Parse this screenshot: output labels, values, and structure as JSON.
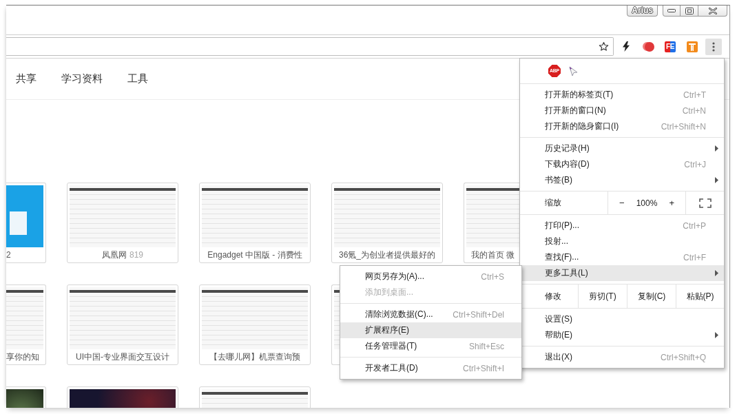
{
  "title_bar": {
    "user_badge": "Arius"
  },
  "toolbar": {
    "extension_badge": "FE"
  },
  "nav": {
    "links": [
      "共享",
      "学习资料",
      "工具"
    ]
  },
  "tile_rows": [
    {
      "tiles": [
        {
          "kind": "app",
          "title": "2"
        },
        {
          "kind": "page",
          "title": "凤凰网",
          "count": "819"
        },
        {
          "kind": "page",
          "title": "Engadget 中国版 - 消费性"
        },
        {
          "kind": "page",
          "title": "36氪_为创业者提供最好的"
        },
        {
          "kind": "page",
          "title": "我的首页 微"
        }
      ]
    },
    {
      "tiles": [
        {
          "kind": "page",
          "title": "享你的知"
        },
        {
          "kind": "page",
          "title": "UI中国-专业界面交互设计"
        },
        {
          "kind": "page",
          "title": "【去哪儿网】机票查询预"
        },
        {
          "kind": "page"
        }
      ]
    },
    {
      "tiles": [
        {
          "kind": "photo"
        },
        {
          "kind": "dark-page"
        },
        {
          "kind": "page"
        }
      ]
    }
  ],
  "menu": {
    "extension_badge": "ABP",
    "sections": [
      {
        "kind": "items",
        "items": [
          {
            "label": "打开新的标签页(T)",
            "shortcut": "Ctrl+T",
            "has_submenu": false,
            "selected": false
          },
          {
            "label": "打开新的窗口(N)",
            "shortcut": "Ctrl+N",
            "has_submenu": false,
            "selected": false
          },
          {
            "label": "打开新的隐身窗口(I)",
            "shortcut": "Ctrl+Shift+N",
            "has_submenu": false,
            "selected": false
          }
        ]
      },
      {
        "kind": "items",
        "items": [
          {
            "label": "历史记录(H)",
            "has_submenu": true,
            "selected": false
          },
          {
            "label": "下载内容(D)",
            "shortcut": "Ctrl+J",
            "has_submenu": false,
            "selected": false
          },
          {
            "label": "书签(B)",
            "has_submenu": true,
            "selected": false
          }
        ]
      },
      {
        "kind": "zoom",
        "label": "缩放",
        "decrease": "−",
        "reading": "100%",
        "increase": "+"
      },
      {
        "kind": "items",
        "items": [
          {
            "label": "打印(P)...",
            "shortcut": "Ctrl+P",
            "has_submenu": false,
            "selected": false
          },
          {
            "label": "投射...",
            "has_submenu": false,
            "selected": false
          },
          {
            "label": "查找(F)...",
            "shortcut": "Ctrl+F",
            "has_submenu": false,
            "selected": false
          },
          {
            "label": "更多工具(L)",
            "has_submenu": true,
            "selected": true
          }
        ]
      },
      {
        "kind": "edit",
        "label": "修改",
        "actions": [
          "剪切(T)",
          "复制(C)",
          "粘贴(P)"
        ]
      },
      {
        "kind": "items",
        "items": [
          {
            "label": "设置(S)",
            "has_submenu": false,
            "selected": false
          },
          {
            "label": "帮助(E)",
            "has_submenu": true,
            "selected": false
          }
        ]
      },
      {
        "kind": "items",
        "items": [
          {
            "label": "退出(X)",
            "shortcut": "Ctrl+Shift+Q",
            "has_submenu": false,
            "selected": false
          }
        ]
      }
    ]
  },
  "submenu": {
    "sections": [
      {
        "items": [
          {
            "label": "网页另存为(A)...",
            "shortcut": "Ctrl+S",
            "disabled": false,
            "selected": false
          },
          {
            "label": "添加到桌面...",
            "disabled": true,
            "selected": false
          }
        ]
      },
      {
        "items": [
          {
            "label": "清除浏览数据(C)...",
            "shortcut": "Ctrl+Shift+Del",
            "disabled": false,
            "selected": false
          },
          {
            "label": "扩展程序(E)",
            "disabled": false,
            "selected": true
          },
          {
            "label": "任务管理器(T)",
            "shortcut": "Shift+Esc",
            "disabled": false,
            "selected": false
          }
        ]
      },
      {
        "items": [
          {
            "label": "开发者工具(D)",
            "shortcut": "Ctrl+Shift+I",
            "disabled": false,
            "selected": false
          }
        ]
      }
    ]
  }
}
